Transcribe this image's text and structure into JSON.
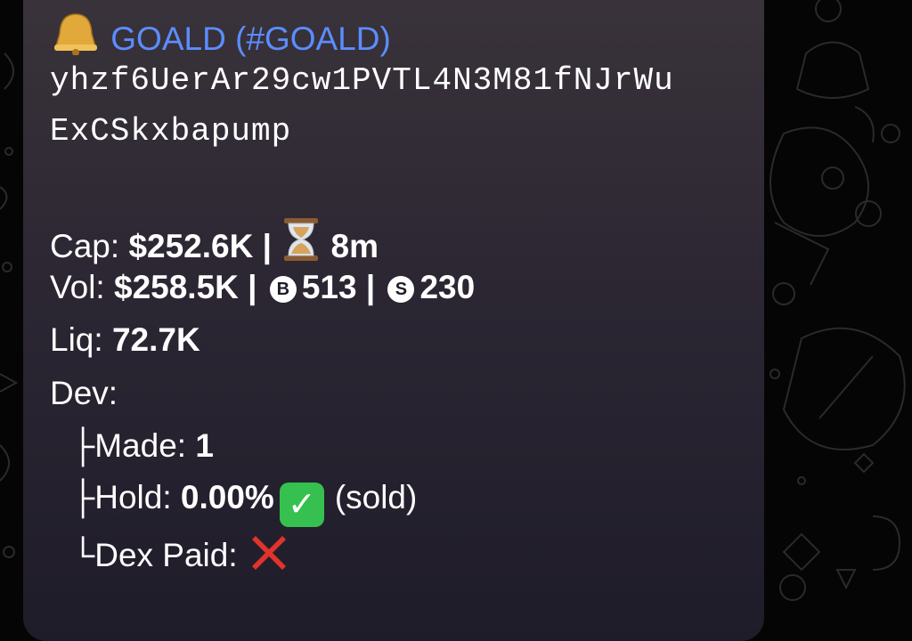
{
  "message": {
    "title_icon": "bell-icon",
    "title": "GOALD (#GOALD)",
    "address_line1": "yhzf6UerAr29cw1PVTL4N3M81fNJrWu",
    "address_line2": "ExCSkxbapump",
    "cap_label": "Cap:",
    "cap_value": "$252.6K",
    "separator": "|",
    "age_icon": "hourglass-icon",
    "age_value": "8m",
    "vol_label": "Vol:",
    "vol_value": "$258.5K",
    "buys_icon_letter": "B",
    "buys_value": "513",
    "sells_icon_letter": "S",
    "sells_value": "230",
    "liq_label": "Liq:",
    "liq_value": "72.7K",
    "dev_label": "Dev:",
    "made_prefix": "├",
    "made_label": "Made:",
    "made_value": "1",
    "hold_prefix": "├",
    "hold_label": "Hold:",
    "hold_value": "0.00%",
    "hold_icon": "check-mark-icon",
    "hold_status": "(sold)",
    "paid_prefix": "└",
    "paid_label": "Dex Paid:",
    "paid_icon": "cross-mark-icon"
  },
  "colors": {
    "title": "#5b8dff",
    "bubble_top": "#3b343b",
    "bubble_bottom": "#1f1c2a",
    "check": "#35c04f",
    "cross": "#e0332b"
  }
}
